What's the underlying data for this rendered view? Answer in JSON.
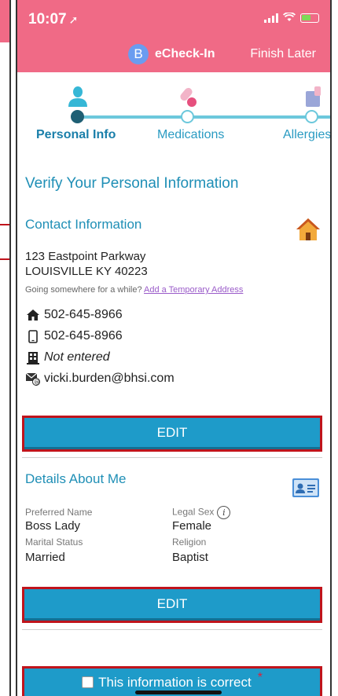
{
  "status_bar": {
    "time": "10:07",
    "location_glyph": "➚"
  },
  "header": {
    "brand_initial": "B",
    "brand_name": "eCheck-In",
    "finish_later": "Finish Later",
    "bg_color": "#f06a86"
  },
  "stepper": {
    "steps": [
      {
        "label": "Personal Info",
        "icon": "person-icon",
        "active": true
      },
      {
        "label": "Medications",
        "icon": "pills-icon",
        "active": false
      },
      {
        "label": "Allergies",
        "icon": "allergies-icon",
        "active": false
      }
    ]
  },
  "page": {
    "title": "Verify Your Personal Information"
  },
  "contact": {
    "title": "Contact Information",
    "icon": "house-icon",
    "address_line1": "123 Eastpoint Parkway",
    "address_line2": "LOUISVILLE KY 40223",
    "temp_prompt": "Going somewhere for a while?",
    "temp_link": "Add a Temporary Address",
    "home_phone": "502-645-8966",
    "mobile_phone": "502-645-8966",
    "work_phone": "Not entered",
    "email": "vicki.burden@bhsi.com",
    "edit_label": "EDIT"
  },
  "details": {
    "title": "Details About Me",
    "icon": "id-card-icon",
    "preferred_name_label": "Preferred Name",
    "preferred_name": "Boss Lady",
    "legal_sex_label": "Legal Sex",
    "legal_sex": "Female",
    "marital_status_label": "Marital Status",
    "marital_status": "Married",
    "religion_label": "Religion",
    "religion": "Baptist",
    "edit_label": "EDIT"
  },
  "confirm": {
    "label": "This information is correct",
    "required_mark": "*",
    "checked": false
  },
  "colors": {
    "accent": "#1e9bc9",
    "title": "#1f8fb6",
    "highlight_border": "#c0141c"
  }
}
